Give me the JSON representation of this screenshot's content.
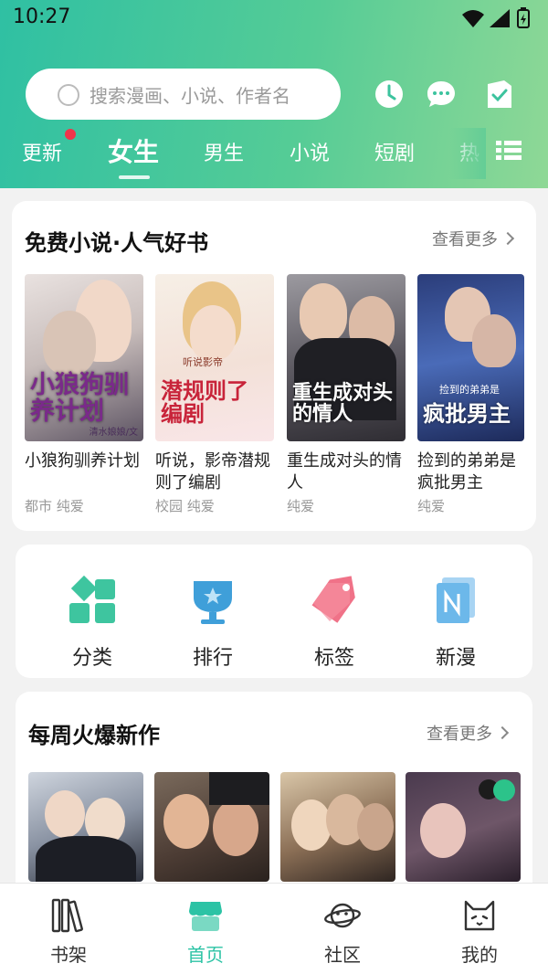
{
  "status_bar": {
    "time": "10:27"
  },
  "search": {
    "placeholder": "搜索漫画、小说、作者名"
  },
  "header_icons": [
    "history-clock-icon",
    "message-icon",
    "checkin-icon"
  ],
  "tabs": [
    {
      "label": "更新",
      "badge": true
    },
    {
      "label": "女生",
      "active": true
    },
    {
      "label": "男生"
    },
    {
      "label": "小说"
    },
    {
      "label": "短剧"
    },
    {
      "label": "热"
    }
  ],
  "free_novels": {
    "title": "免费小说·人气好书",
    "more": "查看更多",
    "books": [
      {
        "name": "小狼狗驯养计划",
        "tags": "都市 纯爱",
        "cover_text": "小狼狗驯养计划",
        "cover_sub": "清水娘娘/文"
      },
      {
        "name": "听说，影帝潜规则了编剧",
        "tags": "校园 纯爱",
        "cover_text": "潜规则了编剧",
        "cover_sub": "听说影帝"
      },
      {
        "name": "重生成对头的情人",
        "tags": "纯爱",
        "cover_text": "重生成对头的情人",
        "cover_sub": ""
      },
      {
        "name": "捡到的弟弟是疯批男主",
        "tags": "纯爱",
        "cover_text": "疯批男主",
        "cover_sub": "捡到的弟弟是"
      }
    ]
  },
  "quick_entries": [
    {
      "label": "分类",
      "icon": "category-grid-icon"
    },
    {
      "label": "排行",
      "icon": "ranking-trophy-icon"
    },
    {
      "label": "标签",
      "icon": "tag-icon"
    },
    {
      "label": "新漫",
      "icon": "new-manga-icon"
    }
  ],
  "weekly": {
    "title": "每周火爆新作",
    "more": "查看更多"
  },
  "bottom_nav": [
    {
      "label": "书架",
      "icon": "bookshelf-icon"
    },
    {
      "label": "首页",
      "icon": "home-store-icon",
      "active": true
    },
    {
      "label": "社区",
      "icon": "planet-community-icon"
    },
    {
      "label": "我的",
      "icon": "cat-profile-icon"
    }
  ],
  "colors": {
    "accent": "#2cc3a5",
    "badge": "#f0354a",
    "header_gradient_start": "#2fc0a3",
    "header_gradient_end": "#8fd896"
  }
}
